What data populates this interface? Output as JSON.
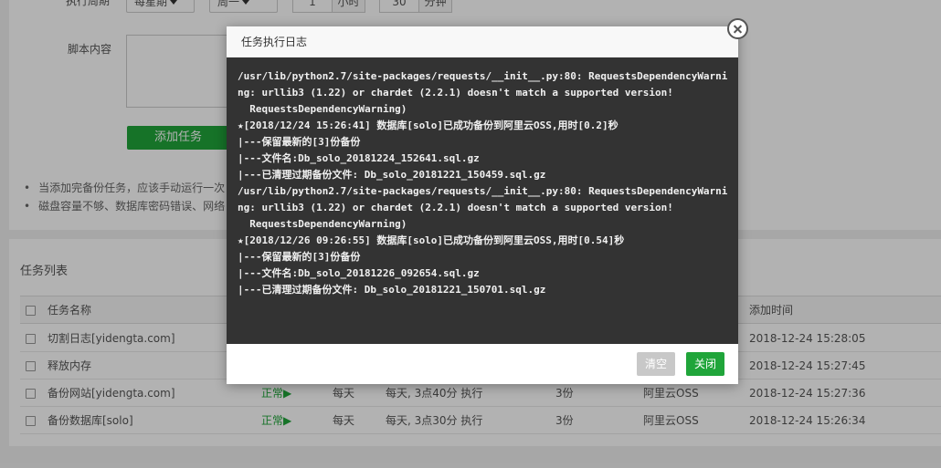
{
  "form": {
    "cycle_label": "执行周期",
    "cycle_select": "每星期",
    "weekday_select": "周一",
    "hour_value": "1",
    "hour_unit": "小时",
    "minute_value": "30",
    "minute_unit": "分钟",
    "script_label": "脚本内容",
    "add_button": "添加任务",
    "tips": [
      "当添加完备份任务，应该手动运行一次",
      "磁盘容量不够、数据库密码错误、网络"
    ]
  },
  "task_list": {
    "title": "任务列表",
    "columns": {
      "name": "任务名称",
      "added": "添加时间"
    },
    "rows": [
      {
        "name": "切割日志[yidengta.com]",
        "status": "",
        "period": "",
        "schedule": "",
        "keep": "",
        "target": "",
        "added": "2018-12-24 15:28:05"
      },
      {
        "name": "释放内存",
        "status": "",
        "period": "",
        "schedule": "",
        "keep": "",
        "target": "",
        "added": "2018-12-24 15:27:45"
      },
      {
        "name": "备份网站[yidengta.com]",
        "status": "正常▶",
        "period": "每天",
        "schedule": "每天, 3点40分 执行",
        "keep": "3份",
        "target": "阿里云OSS",
        "added": "2018-12-24 15:27:36"
      },
      {
        "name": "备份数据库[solo]",
        "status": "正常▶",
        "period": "每天",
        "schedule": "每天, 3点30分 执行",
        "keep": "3份",
        "target": "阿里云OSS",
        "added": "2018-12-24 15:26:34"
      }
    ]
  },
  "modal": {
    "title": "任务执行日志",
    "log_lines": [
      "/usr/lib/python2.7/site-packages/requests/__init__.py:80: RequestsDependencyWarni",
      "ng: urllib3 (1.22) or chardet (2.2.1) doesn't match a supported version!",
      "  RequestsDependencyWarning)",
      "★[2018/12/24 15:26:41] 数据库[solo]已成功备份到阿里云OSS,用时[0.2]秒",
      "|---保留最新的[3]份备份",
      "|---文件名:Db_solo_20181224_152641.sql.gz",
      "|---已清理过期备份文件: Db_solo_20181221_150459.sql.gz",
      "/usr/lib/python2.7/site-packages/requests/__init__.py:80: RequestsDependencyWarni",
      "ng: urllib3 (1.22) or chardet (2.2.1) doesn't match a supported version!",
      "  RequestsDependencyWarning)",
      "★[2018/12/26 09:26:55] 数据库[solo]已成功备份到阿里云OSS,用时[0.54]秒",
      "|---保留最新的[3]份备份",
      "|---文件名:Db_solo_20181226_092654.sql.gz",
      "|---已清理过期备份文件: Db_solo_20181221_150701.sql.gz"
    ],
    "clear_button": "清空",
    "close_button": "关闭"
  },
  "colors": {
    "accent": "#20a53a",
    "log_bg": "#333333"
  }
}
